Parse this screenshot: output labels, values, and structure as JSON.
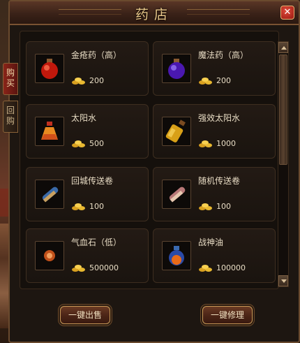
{
  "window": {
    "title": "药店"
  },
  "tabs": [
    {
      "label": "购买",
      "active": true
    },
    {
      "label": "回购",
      "active": false
    }
  ],
  "items": [
    {
      "name": "金疮药（高）",
      "price": "200",
      "icon": "red-potion-icon"
    },
    {
      "name": "魔法药（高）",
      "price": "200",
      "icon": "purple-potion-icon"
    },
    {
      "name": "太阳水",
      "price": "500",
      "icon": "sun-water-flask-icon"
    },
    {
      "name": "强效太阳水",
      "price": "1000",
      "icon": "strong-sun-water-bottle-icon"
    },
    {
      "name": "回城传送卷",
      "price": "100",
      "icon": "town-scroll-icon"
    },
    {
      "name": "随机传送卷",
      "price": "100",
      "icon": "random-scroll-icon"
    },
    {
      "name": "气血石（低）",
      "price": "500000",
      "icon": "vitality-stone-icon"
    },
    {
      "name": "战神油",
      "price": "100000",
      "icon": "war-god-oil-icon"
    }
  ],
  "buttons": {
    "sell_all": "一键出售",
    "repair_all": "一键修理"
  },
  "colors": {
    "accent_gold": "#e8c88a",
    "active_tab_red": "#8a2418",
    "border_bronze": "#c89a58"
  }
}
